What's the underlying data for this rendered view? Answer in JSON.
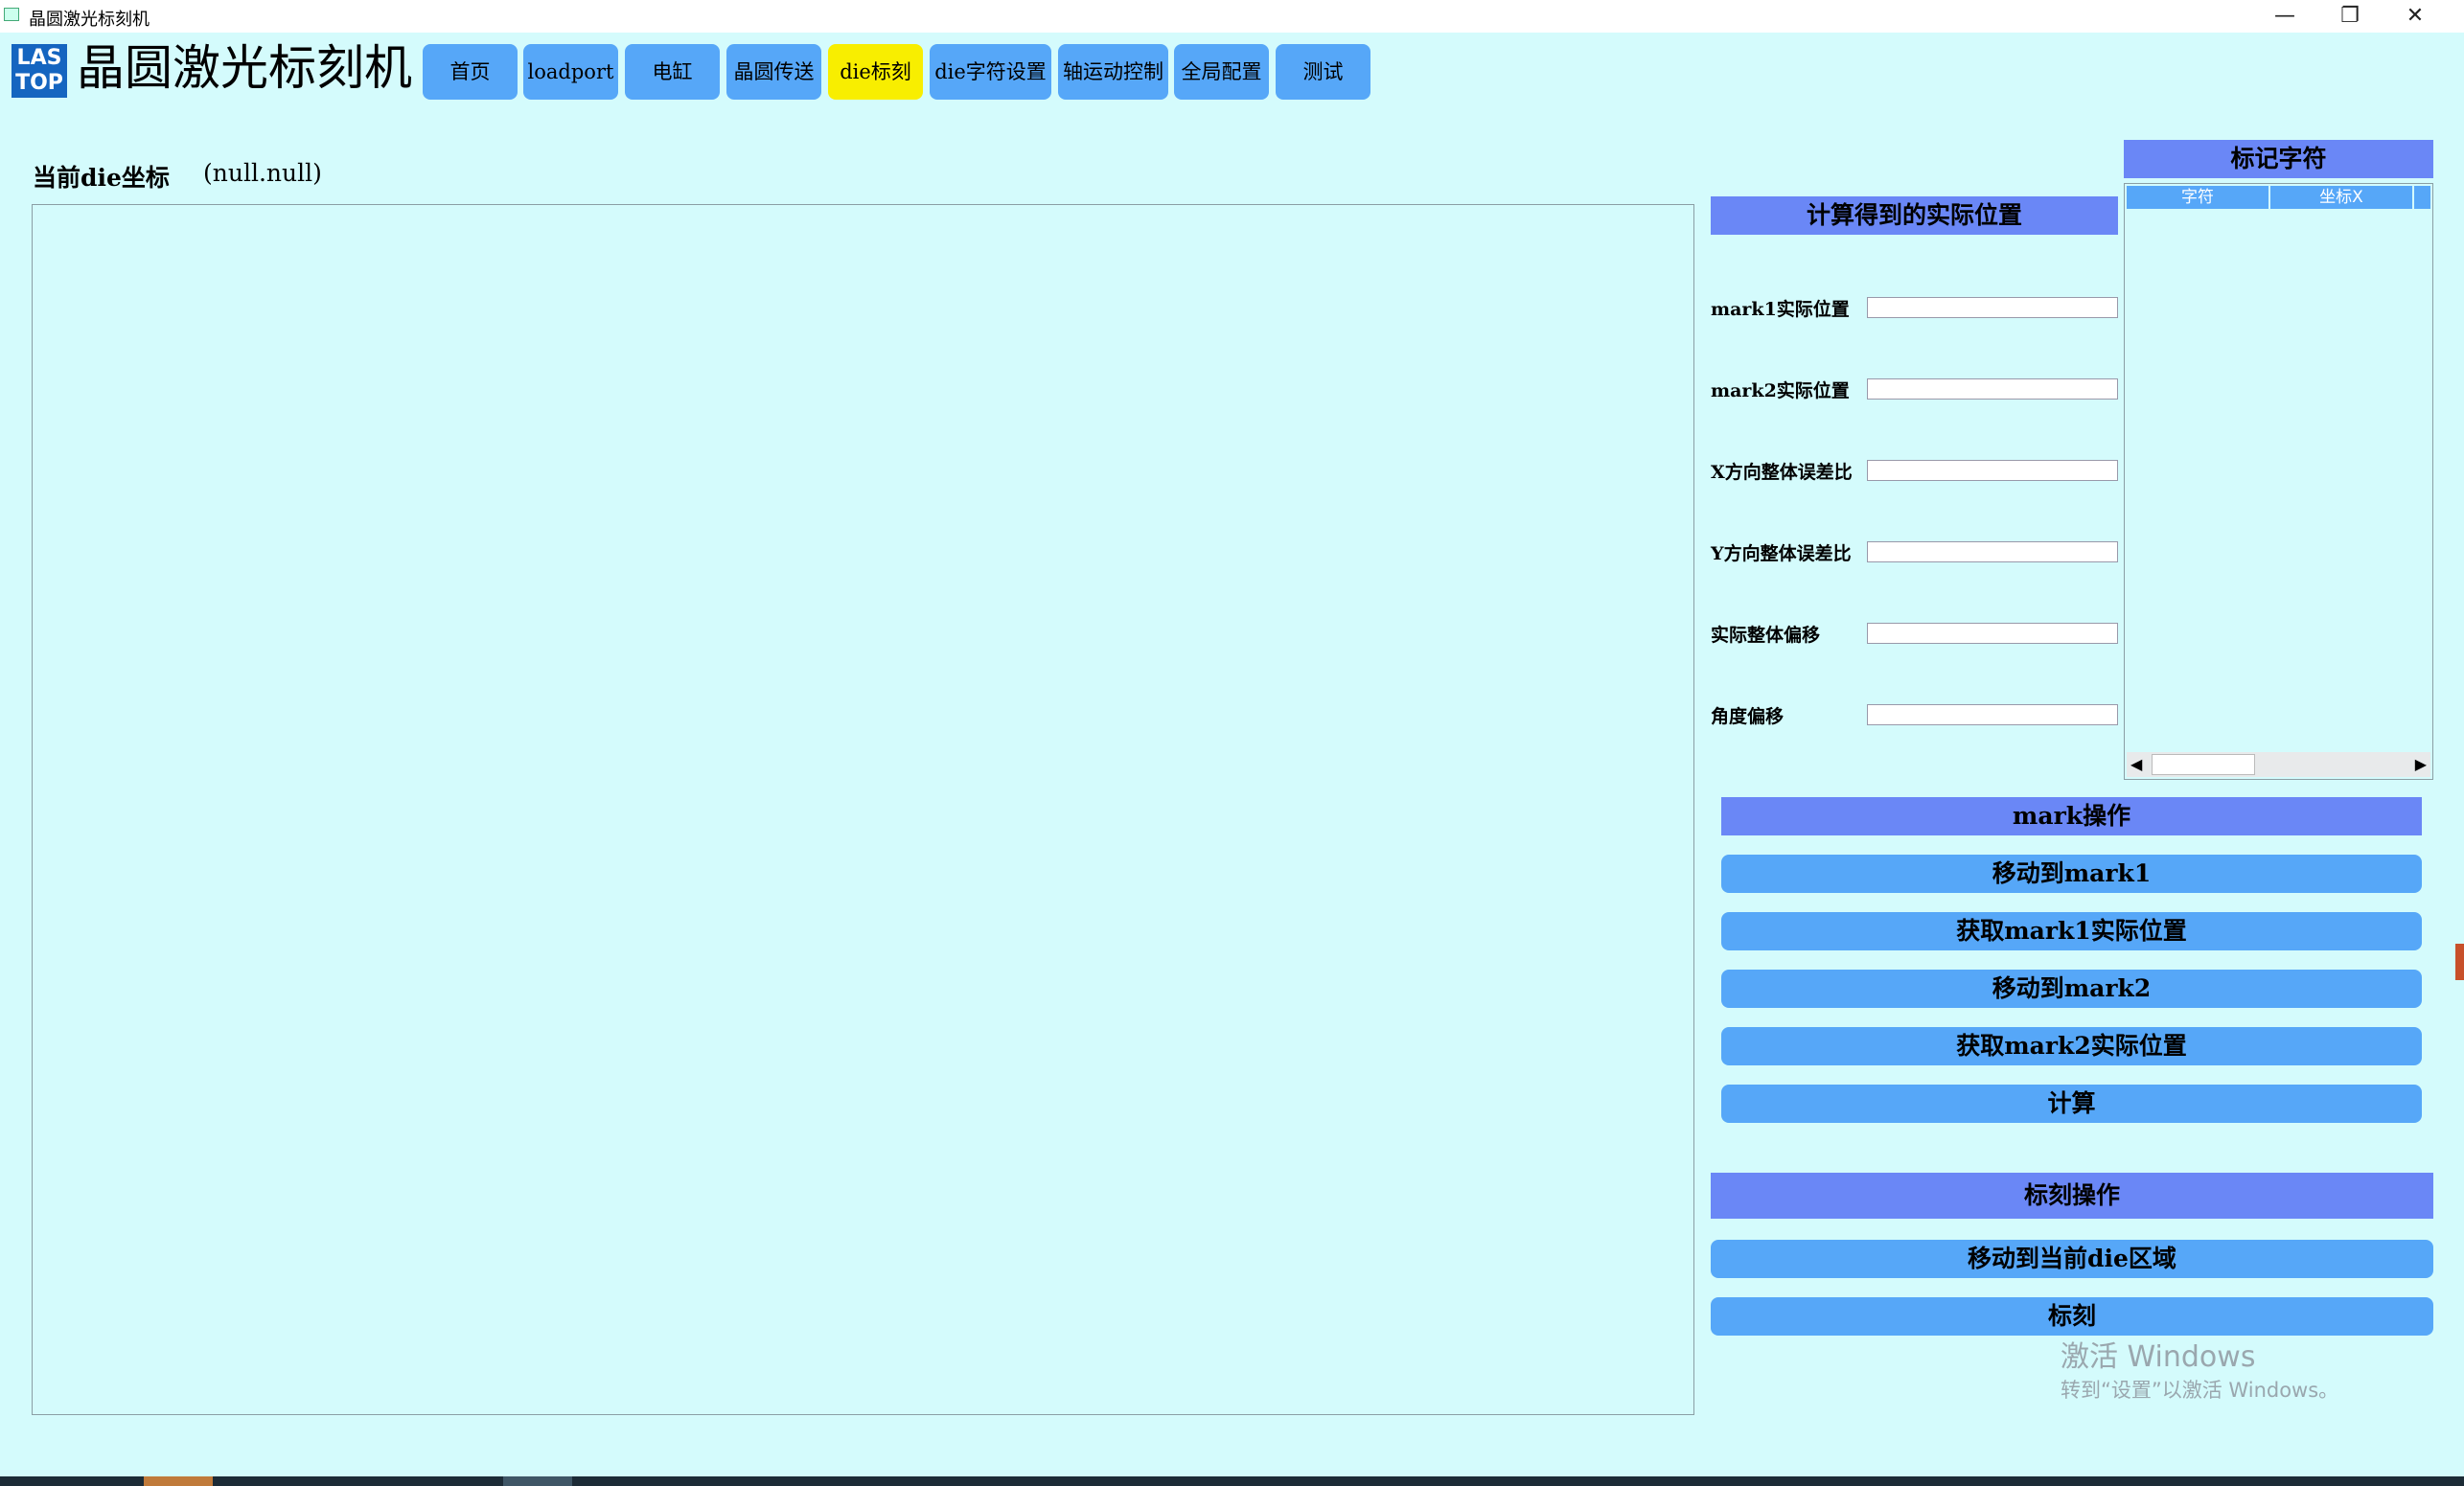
{
  "window": {
    "title": "晶圆激光标刻机",
    "minimize_glyph": "—",
    "maximize_glyph": "❐",
    "close_glyph": "✕"
  },
  "header": {
    "logo_line1": "LAS",
    "logo_line2": "TOP",
    "app_title": "晶圆激光标刻机"
  },
  "nav": {
    "tabs": [
      {
        "label": "首页"
      },
      {
        "label": "loadport"
      },
      {
        "label": "电缸"
      },
      {
        "label": "晶圆传送"
      },
      {
        "label": "die标刻"
      },
      {
        "label": "die字符设置"
      },
      {
        "label": "轴运动控制"
      },
      {
        "label": "全局配置"
      },
      {
        "label": "测试"
      }
    ],
    "active_tab": "die标刻",
    "active_color": "#f8ee00",
    "tab_color": "#56a7f8"
  },
  "main": {
    "coord_label": "当前die坐标",
    "coord_value": "(null.null)"
  },
  "calc_panel": {
    "header": "计算得到的实际位置",
    "fields": [
      {
        "label": "mark1实际位置",
        "value": ""
      },
      {
        "label": "mark2实际位置",
        "value": ""
      },
      {
        "label": "X方向整体误差比",
        "value": ""
      },
      {
        "label": "Y方向整体误差比",
        "value": ""
      },
      {
        "label": "实际整体偏移",
        "value": ""
      },
      {
        "label": "角度偏移",
        "value": ""
      }
    ]
  },
  "mark_table": {
    "header": "标记字符",
    "columns": [
      "字符",
      "坐标X"
    ],
    "rows": [],
    "scroll_left_glyph": "◀",
    "scroll_right_glyph": "▶"
  },
  "mark_ops": {
    "header": "mark操作",
    "buttons": [
      "移动到mark1",
      "获取mark1实际位置",
      "移动到mark2",
      "获取mark2实际位置",
      "计算"
    ]
  },
  "engrave_ops": {
    "header": "标刻操作",
    "buttons": [
      "移动到当前die区域",
      "标刻"
    ]
  },
  "watermark": {
    "title": "激活 Windows",
    "subtitle": "转到“设置”以激活 Windows。"
  },
  "colors": {
    "background": "#d4fbfc",
    "header_bar": "#6a87f6",
    "button": "#56a7f8"
  }
}
